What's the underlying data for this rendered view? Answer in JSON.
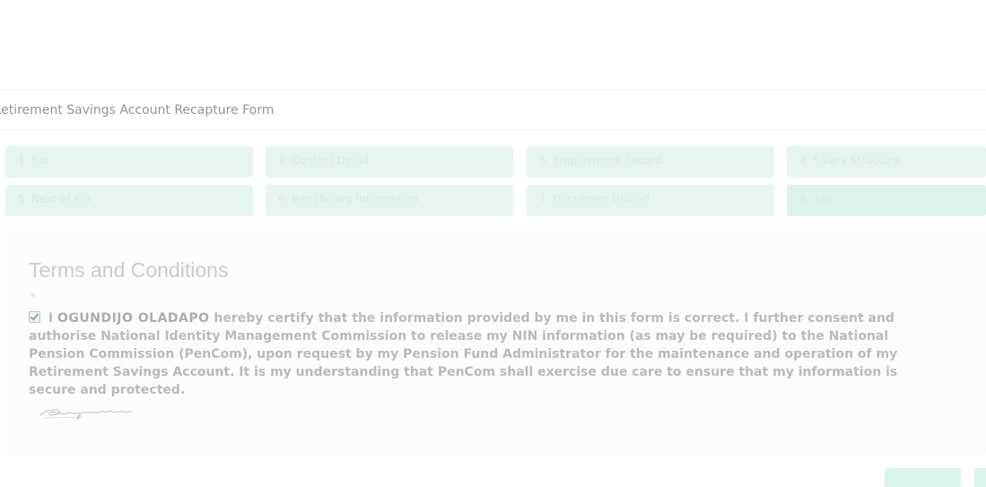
{
  "form": {
    "title": "Retirement Savings Account Recapture Form"
  },
  "steps": [
    {
      "label": "1. Bio"
    },
    {
      "label": "2. Contact Detail"
    },
    {
      "label": "3. Employment Record"
    },
    {
      "label": "4. Salary Structure"
    },
    {
      "label": "5. Next of Kin"
    },
    {
      "label": "6. Beneficiary Information"
    },
    {
      "label": "7. Document Upload"
    },
    {
      "label": "8. T&C"
    }
  ],
  "terms": {
    "title": "Terms and Conditions",
    "required_mark": "*",
    "declaration_prefix": "I",
    "declarant_name": "OGUNDIJO OLADAPO",
    "declaration_text": "hereby certify that the information provided by me in this form is correct. I further consent and authorise National Identity Management Commission to release my NIN information (as may be required) to the National Pension Commission (PenCom), upon request by my Pension Fund Administrator for the maintenance and operation of my Retirement Savings Account. It is my understanding that PenCom shall exercise due care to ensure that my information is secure and protected.",
    "accepted": true
  },
  "colors": {
    "accent": "#ddf3ee",
    "text_muted": "#b7bcba"
  }
}
